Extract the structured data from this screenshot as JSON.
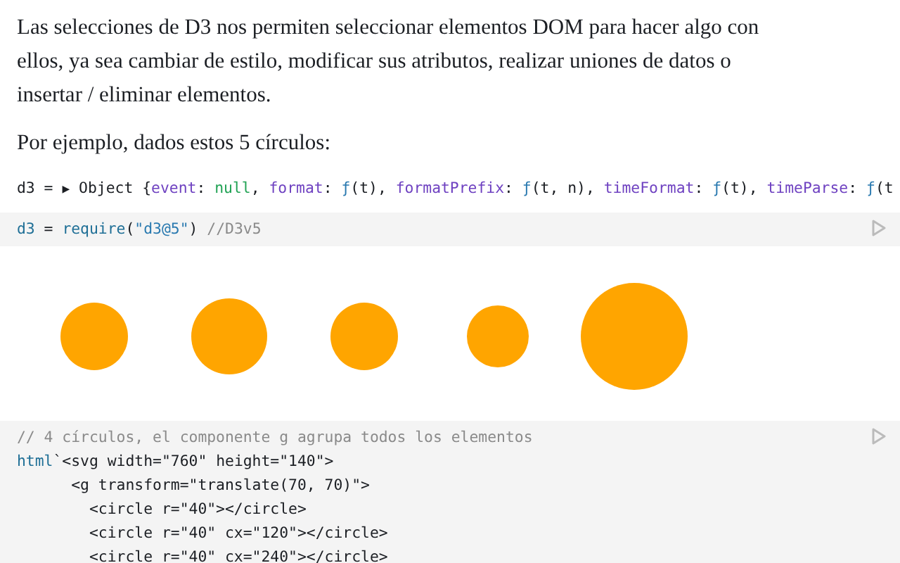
{
  "paragraphs": [
    "Las selecciones de D3 nos permiten seleccionar elementos DOM para hacer algo con ellos, ya sea cambiar de estilo, modificar sus atributos, realizar uniones de datos o insertar / eliminar elementos.",
    "Por ejemplo, dados estos 5 círculos:"
  ],
  "output": {
    "lines": [
      [
        {
          "kind": "plain",
          "text": "d3 = "
        },
        {
          "kind": "toggle",
          "text": "▶"
        },
        {
          "kind": "plain",
          "text": " Object {"
        },
        {
          "kind": "key",
          "text": "event"
        },
        {
          "kind": "plain",
          "text": ": "
        },
        {
          "kind": "null",
          "text": "null"
        },
        {
          "kind": "plain",
          "text": ", "
        },
        {
          "kind": "key",
          "text": "format"
        },
        {
          "kind": "plain",
          "text": ": "
        },
        {
          "kind": "fn",
          "text": "ƒ"
        },
        {
          "kind": "plain",
          "text": "(t), "
        },
        {
          "kind": "key",
          "text": "formatPrefix"
        },
        {
          "kind": "plain",
          "text": ": "
        },
        {
          "kind": "fn",
          "text": "ƒ"
        },
        {
          "kind": "plain",
          "text": "(t, n), "
        },
        {
          "kind": "key",
          "text": "timeFormat"
        },
        {
          "kind": "plain",
          "text": ": "
        },
        {
          "kind": "fn",
          "text": "ƒ"
        },
        {
          "kind": "plain",
          "text": "(t), "
        },
        {
          "kind": "key",
          "text": "timeParse"
        },
        {
          "kind": "plain",
          "text": ": "
        },
        {
          "kind": "fn",
          "text": "ƒ"
        },
        {
          "kind": "plain",
          "text": "(t"
        }
      ]
    ]
  },
  "cells": [
    {
      "kind": "code",
      "lines": [
        [
          {
            "kind": "var",
            "text": "d3"
          },
          {
            "kind": "plain",
            "text": " = "
          },
          {
            "kind": "var",
            "text": "require"
          },
          {
            "kind": "plain",
            "text": "("
          },
          {
            "kind": "string",
            "text": "\"d3@5\""
          },
          {
            "kind": "plain",
            "text": ") "
          },
          {
            "kind": "comment",
            "text": "//D3v5"
          }
        ]
      ]
    },
    {
      "kind": "circles"
    },
    {
      "kind": "code",
      "lines": [
        [
          {
            "kind": "comment",
            "text": "// 4 círculos, el componente g agrupa todos los elementos"
          }
        ],
        [
          {
            "kind": "var",
            "text": "html"
          },
          {
            "kind": "plain",
            "text": "`<svg width=\"760\" height=\"140\">"
          }
        ],
        [
          {
            "kind": "plain",
            "text": "      <g transform=\"translate(70, 70)\">"
          }
        ],
        [
          {
            "kind": "plain",
            "text": "        <circle r=\"40\"></circle>"
          }
        ],
        [
          {
            "kind": "plain",
            "text": "        <circle r=\"40\" cx=\"120\"></circle>"
          }
        ],
        [
          {
            "kind": "plain",
            "text": "        <circle r=\"40\" cx=\"240\"></circle>"
          }
        ]
      ]
    }
  ]
}
